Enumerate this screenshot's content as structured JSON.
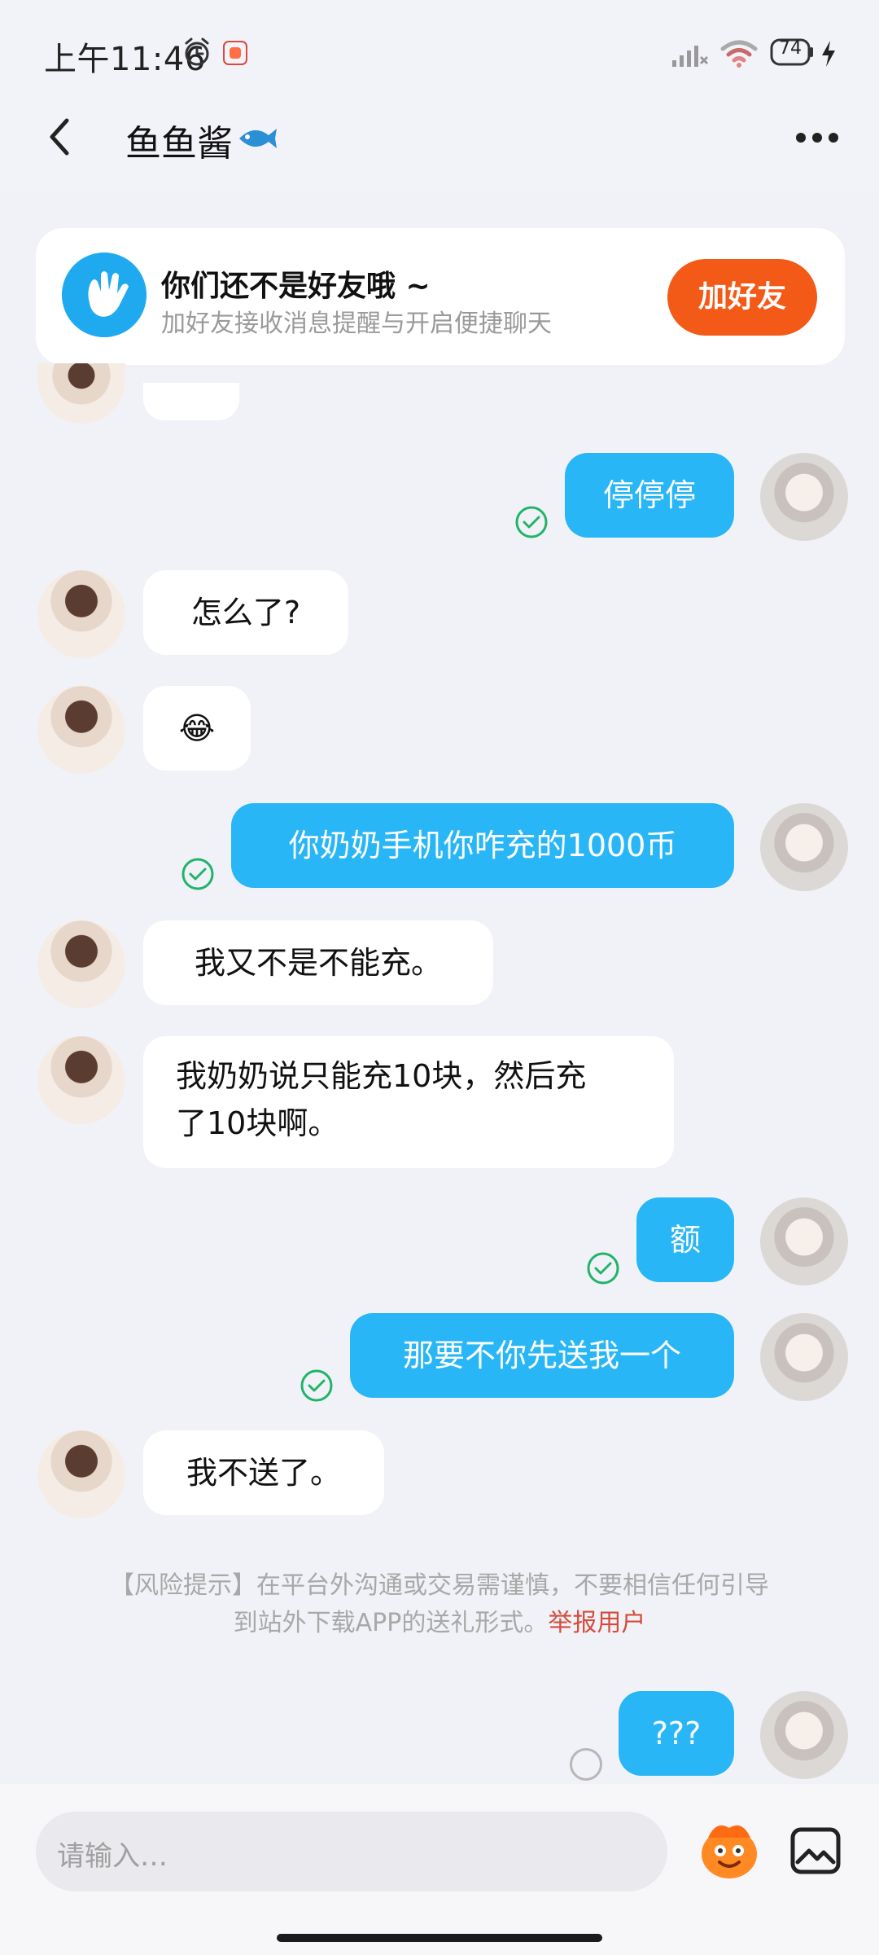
{
  "status_bar": {
    "time": "上午11:46",
    "battery": "74",
    "icons": [
      "alarm-clock-icon",
      "app-notification-icon",
      "signal-icon",
      "wifi-icon",
      "battery-icon",
      "charging-icon"
    ]
  },
  "header": {
    "title": "鱼鱼酱",
    "back_icon": "back-arrow-icon",
    "more_icon": "more-dots-icon"
  },
  "friend_banner": {
    "title": "你们还不是好友哦 ~",
    "subtitle": "加好友接收消息提醒与开启便捷聊天",
    "button": "加好友",
    "icon": "waving-hand-icon"
  },
  "messages": [
    {
      "side": "right",
      "text": "停停停",
      "status": "read"
    },
    {
      "side": "left",
      "text": "怎么了?"
    },
    {
      "side": "left",
      "text": "😂"
    },
    {
      "side": "right",
      "text": "你奶奶手机你咋充的1000币",
      "status": "read"
    },
    {
      "side": "left",
      "text": "我又不是不能充。"
    },
    {
      "side": "left",
      "line1": "我奶奶说只能充10块，然后充",
      "line2": "了10块啊。"
    },
    {
      "side": "right",
      "text": "额",
      "status": "read"
    },
    {
      "side": "right",
      "text": "那要不你先送我一个",
      "status": "read"
    },
    {
      "side": "left",
      "text": "我不送了。"
    },
    {
      "side": "right",
      "text": "???",
      "status": "pending"
    }
  ],
  "risk_notice": {
    "line1": "【风险提示】在平台外沟通或交易需谨慎，不要相信任何引导",
    "line2": "到站外下载APP的送礼形式。",
    "report_link": "举报用户"
  },
  "composer": {
    "placeholder": "请输入…",
    "emoji_icon": "emoji-mascot-icon",
    "image_icon": "image-gallery-icon"
  },
  "colors": {
    "accent": "#29b6f6",
    "button": "#f45a17",
    "read_check": "#20b46a",
    "report": "#d64b3d"
  }
}
